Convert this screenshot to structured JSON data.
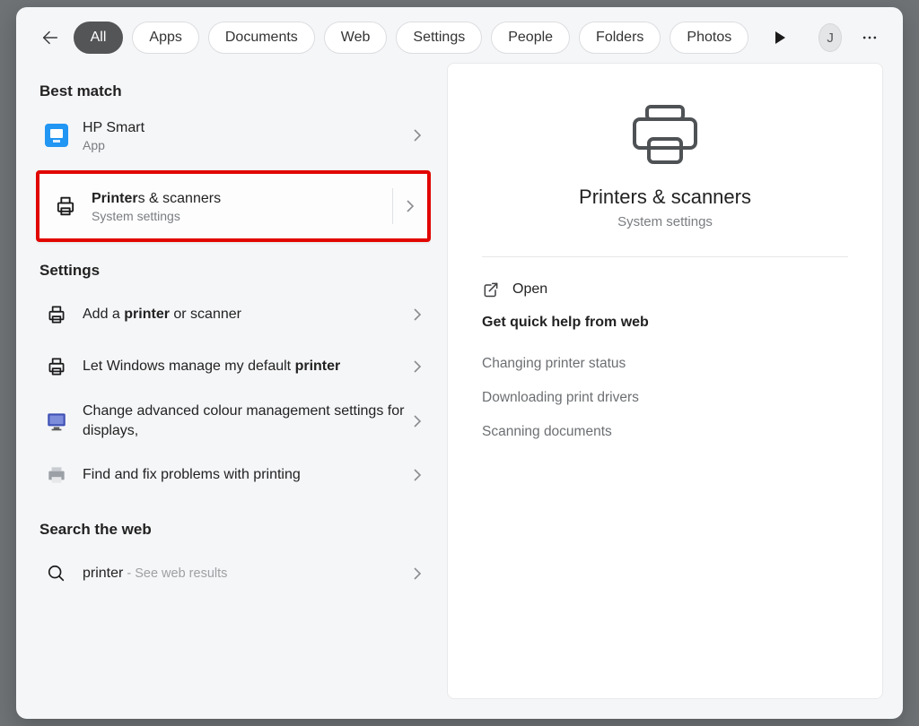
{
  "topbar": {
    "tabs": [
      "All",
      "Apps",
      "Documents",
      "Web",
      "Settings",
      "People",
      "Folders",
      "Photos"
    ],
    "active_index": 0,
    "avatar_letter": "J"
  },
  "sections": {
    "best_match": {
      "title": "Best match",
      "items": [
        {
          "title": "HP Smart",
          "subtitle": "App",
          "icon": "hp-smart-icon"
        }
      ]
    },
    "highlight": {
      "title_html": "<b>Printer</b>s & scanners",
      "subtitle": "System settings",
      "icon": "printer-icon"
    },
    "settings": {
      "title": "Settings",
      "items": [
        {
          "title_html": "Add a <b>printer</b> or scanner",
          "icon": "printer-icon"
        },
        {
          "title_html": "Let Windows manage my default <b>printer</b>",
          "icon": "printer-icon"
        },
        {
          "title_html": "Change advanced colour management settings for displays, ",
          "icon": "monitor-icon"
        },
        {
          "title_html": "Find and fix problems with printing",
          "icon": "troubleshoot-printer-icon"
        }
      ]
    },
    "web": {
      "title": "Search the web",
      "item": {
        "query": "printer",
        "suffix": " - See web results",
        "icon": "search-icon"
      }
    }
  },
  "preview": {
    "title": "Printers & scanners",
    "subtitle": "System settings",
    "open_label": "Open",
    "help_title": "Get quick help from web",
    "help_links": [
      "Changing printer status",
      "Downloading print drivers",
      "Scanning documents"
    ]
  }
}
